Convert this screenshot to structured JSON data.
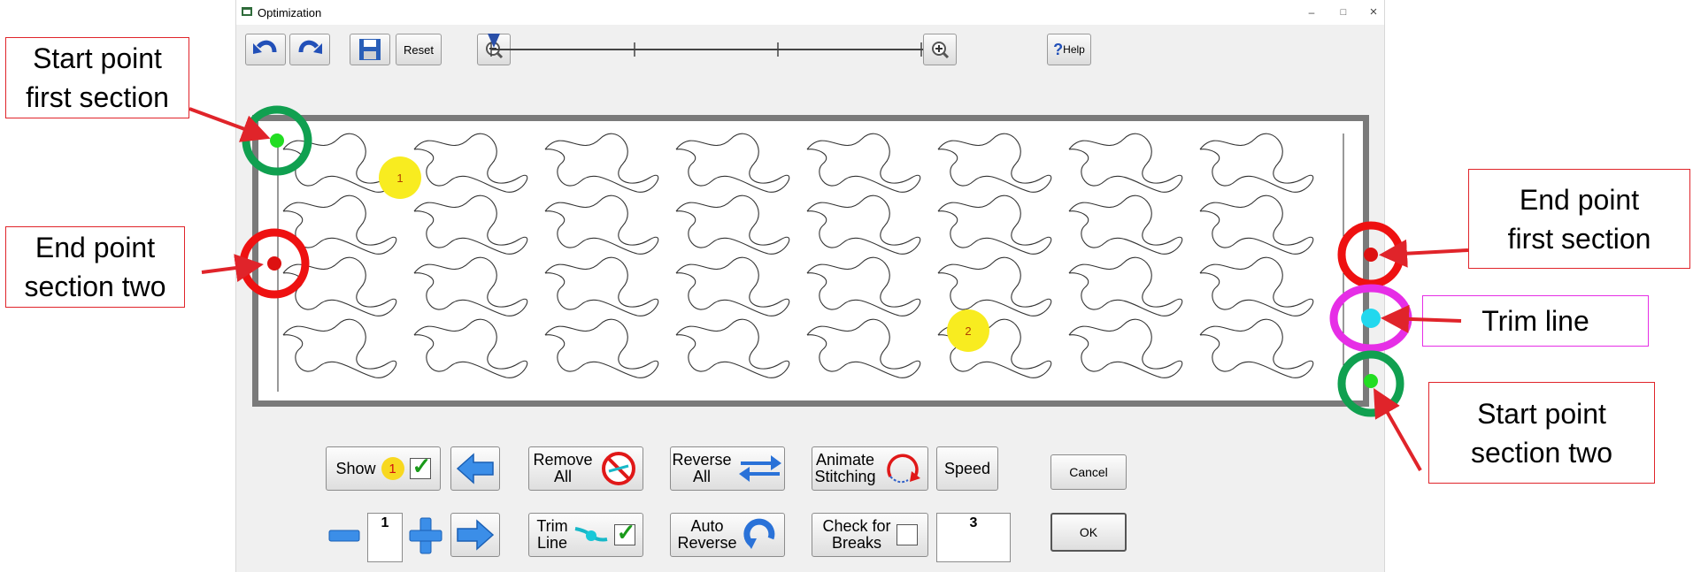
{
  "window": {
    "title": "Optimization",
    "minimize": "–",
    "restore": "□",
    "close": "×"
  },
  "toolbar": {
    "reset_label": "Reset",
    "help_label": "Help",
    "help_glyph": "?",
    "zoom_slider_value": 0
  },
  "canvas": {
    "markers": [
      {
        "label": "1",
        "color": "#f8ec20"
      },
      {
        "label": "2",
        "color": "#f8ec20"
      }
    ],
    "point_colors": {
      "start": "#22dd22",
      "end": "#dd1111",
      "trim": "#22d8ee"
    }
  },
  "bottom": {
    "show_label": "Show",
    "show_badge": "1",
    "show_checked": true,
    "remove_all": [
      "Remove",
      "All"
    ],
    "reverse_all": [
      "Reverse",
      "All"
    ],
    "animate": [
      "Animate",
      "Stitching"
    ],
    "speed_label": "Speed",
    "cancel_label": "Cancel",
    "number_value": "1",
    "trim_line": [
      "Trim",
      "Line"
    ],
    "trim_checked": true,
    "auto_reverse": [
      "Auto",
      "Reverse"
    ],
    "check_breaks": [
      "Check for",
      "Breaks"
    ],
    "check_breaks_checked": false,
    "speed_value": "3",
    "ok_label": "OK"
  },
  "annotations": {
    "start_first": [
      "Start point",
      "first section"
    ],
    "end_two": [
      "End point",
      "section two"
    ],
    "end_first": [
      "End point",
      "first section"
    ],
    "trim": "Trim line",
    "start_two": [
      "Start point",
      "section two"
    ]
  },
  "colors": {
    "annotation_border": "#e0242a",
    "trim_border": "#e62ee6",
    "arrow": "#e0242a",
    "circle_green": "#10a050",
    "circle_red": "#ee1111",
    "circle_magenta": "#e62ee6"
  }
}
